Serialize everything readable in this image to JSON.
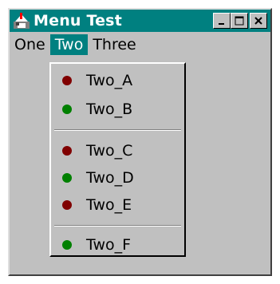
{
  "window": {
    "title": "Menu Test",
    "title_bar_color": "#008080"
  },
  "controls": {
    "minimize_icon": "minimize-icon",
    "maximize_icon": "maximize-icon",
    "close_icon": "close-icon"
  },
  "menubar": {
    "items": [
      {
        "label": "One",
        "active": false
      },
      {
        "label": "Two",
        "active": true
      },
      {
        "label": "Three",
        "active": false
      }
    ]
  },
  "dropdown": {
    "items": [
      {
        "label": "Two_A",
        "color": "#800000"
      },
      {
        "label": "Two_B",
        "color": "#008000"
      },
      {
        "label": "Two_C",
        "color": "#800000"
      },
      {
        "label": "Two_D",
        "color": "#008000"
      },
      {
        "label": "Two_E",
        "color": "#800000"
      },
      {
        "label": "Two_F",
        "color": "#008000"
      }
    ]
  }
}
